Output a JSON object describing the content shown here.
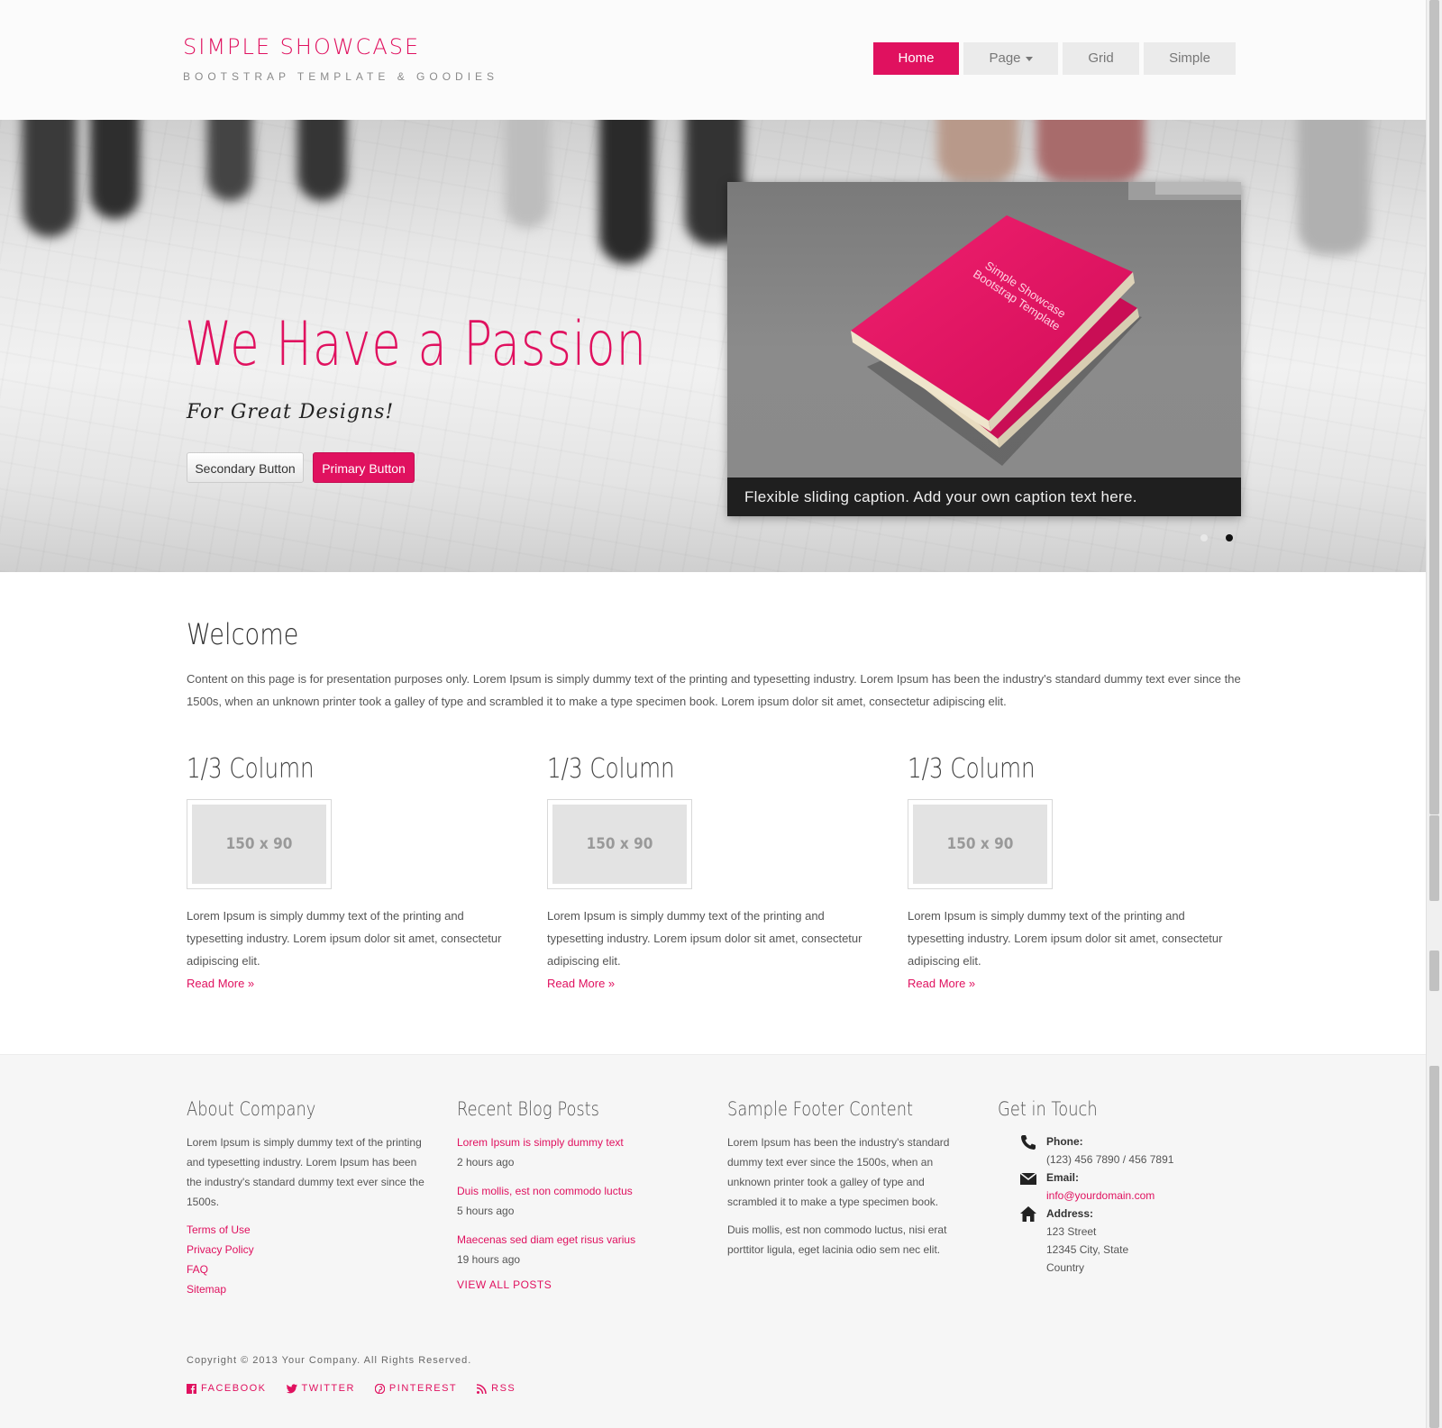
{
  "header": {
    "brand_title": "SIMPLE SHOWCASE",
    "brand_subtitle": "BOOTSTRAP TEMPLATE & GOODIES",
    "nav": [
      {
        "label": "Home",
        "active": true
      },
      {
        "label": "Page",
        "dropdown": true
      },
      {
        "label": "Grid"
      },
      {
        "label": "Simple"
      }
    ]
  },
  "hero": {
    "title": "We Have a Passion",
    "subtitle": "For Great Designs!",
    "secondary_button": "Secondary Button",
    "primary_button": "Primary Button",
    "slider_caption": "Flexible sliding caption. Add your own caption text here.",
    "book_text_line1": "Simple Showcase",
    "book_text_line2": "Bootstrap Template",
    "active_slide_index": 1
  },
  "main": {
    "welcome_title": "Welcome",
    "welcome_text": "Content on this page is for presentation purposes only. Lorem Ipsum is simply dummy text of the printing and typesetting industry. Lorem Ipsum has been the industry's standard dummy text ever since the 1500s, when an unknown printer took a galley of type and scrambled it to make a type specimen book. Lorem ipsum dolor sit amet, consectetur adipiscing elit.",
    "columns": [
      {
        "title": "1/3 Column",
        "placeholder": "150 x 90",
        "text": "Lorem Ipsum is simply dummy text of the printing and typesetting industry. Lorem ipsum dolor sit amet, consectetur adipiscing elit.",
        "link": "Read More »"
      },
      {
        "title": "1/3 Column",
        "placeholder": "150 x 90",
        "text": "Lorem Ipsum is simply dummy text of the printing and typesetting industry. Lorem ipsum dolor sit amet, consectetur adipiscing elit.",
        "link": "Read More »"
      },
      {
        "title": "1/3 Column",
        "placeholder": "150 x 90",
        "text": "Lorem Ipsum is simply dummy text of the printing and typesetting industry. Lorem ipsum dolor sit amet, consectetur adipiscing elit.",
        "link": "Read More »"
      }
    ]
  },
  "footer": {
    "about": {
      "title": "About Company",
      "text": "Lorem Ipsum is simply dummy text of the printing and typesetting industry. Lorem Ipsum has been the industry's standard dummy text ever since the 1500s.",
      "links": [
        "Terms of Use",
        "Privacy Policy",
        "FAQ",
        "Sitemap"
      ]
    },
    "blog": {
      "title": "Recent Blog Posts",
      "posts": [
        {
          "title": "Lorem Ipsum is simply dummy text",
          "time": "2 hours ago"
        },
        {
          "title": "Duis mollis, est non commodo luctus",
          "time": "5 hours ago"
        },
        {
          "title": "Maecenas sed diam eget risus varius",
          "time": "19 hours ago"
        }
      ],
      "view_all": "VIEW ALL POSTS"
    },
    "sample": {
      "title": "Sample Footer Content",
      "text1": "Lorem Ipsum has been the industry's standard dummy text ever since the 1500s, when an unknown printer took a galley of type and scrambled it to make a type specimen book.",
      "text2": "Duis mollis, est non commodo luctus, nisi erat porttitor ligula, eget lacinia odio sem nec elit."
    },
    "contact": {
      "title": "Get in Touch",
      "phone_label": "Phone:",
      "phone": "(123) 456 7890 / 456 7891",
      "email_label": "Email:",
      "email": "info@yourdomain.com",
      "address_label": "Address:",
      "address_line1": "123 Street",
      "address_line2": "12345 City, State",
      "address_line3": "Country"
    },
    "copyright": "Copyright © 2013 Your Company. All Rights Reserved.",
    "social": [
      "FACEBOOK",
      "TWITTER",
      "PINTEREST",
      "RSS"
    ]
  },
  "colors": {
    "accent": "#e0115f",
    "caption_bg": "#1f1f1f",
    "footer_bg": "#f6f6f6"
  },
  "icons": [
    "phone-icon",
    "envelope-icon",
    "home-icon",
    "facebook-icon",
    "twitter-icon",
    "pinterest-icon",
    "rss-icon",
    "caret-down-icon"
  ]
}
